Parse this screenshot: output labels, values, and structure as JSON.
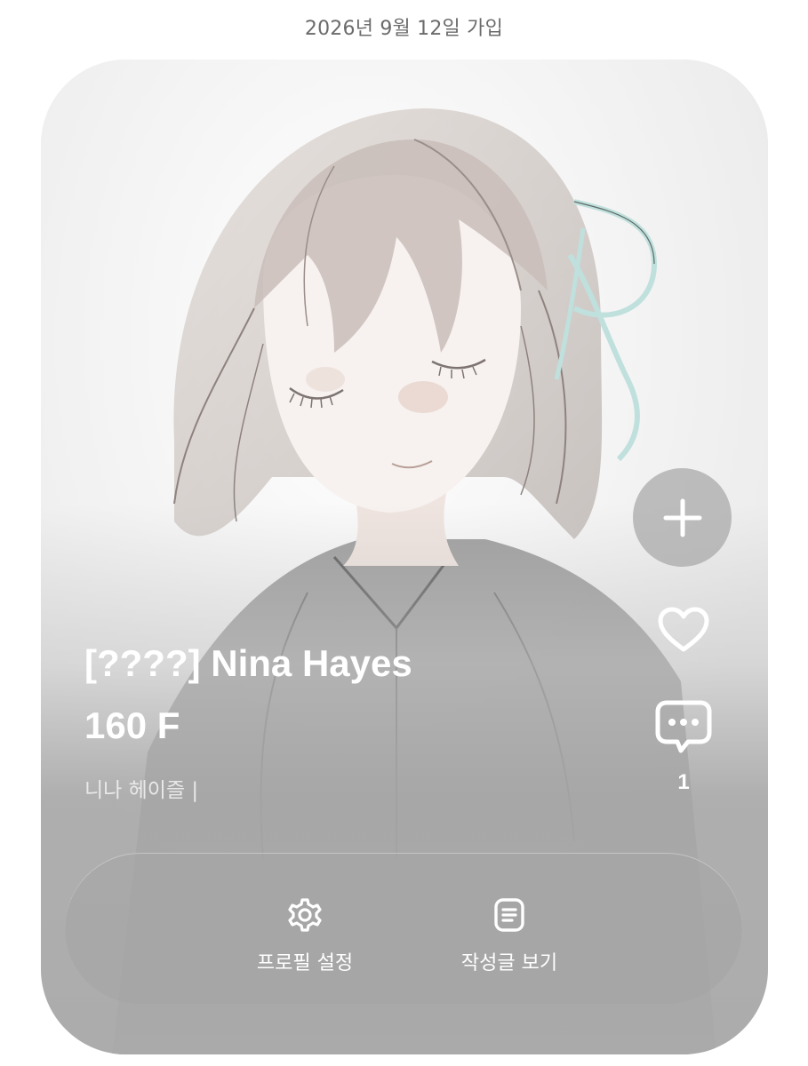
{
  "header": {
    "join_date": "2026년 9월 12일 가입"
  },
  "profile": {
    "title": "[????] Nina Hayes",
    "subtitle": "160 F",
    "korean_name": "니나 헤이즐 |"
  },
  "side_actions": {
    "add_icon": "plus-icon",
    "like_icon": "heart-icon",
    "comment_icon": "chat-bubble-icon",
    "comment_count": "1"
  },
  "action_bar": {
    "items": [
      {
        "label": "프로필 설정",
        "icon": "gear-icon"
      },
      {
        "label": "작성글 보기",
        "icon": "document-icon"
      }
    ]
  },
  "colors": {
    "card_bg": "#eeeeee",
    "overlay_gray": "#aaaaaa",
    "text_white": "#ffffff",
    "ribbon": "#bfe0dc"
  }
}
